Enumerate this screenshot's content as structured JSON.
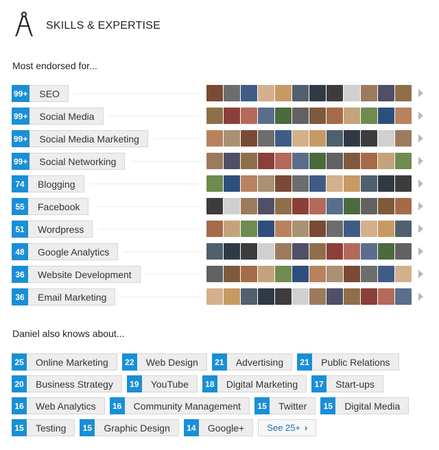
{
  "header": {
    "title": "SKILLS & EXPERTISE",
    "icon": "compass-icon"
  },
  "most_endorsed": {
    "label": "Most endorsed for...",
    "skills": [
      {
        "count": "99+",
        "name": "SEO"
      },
      {
        "count": "99+",
        "name": "Social Media"
      },
      {
        "count": "99+",
        "name": "Social Media Marketing"
      },
      {
        "count": "99+",
        "name": "Social Networking"
      },
      {
        "count": "74",
        "name": "Blogging"
      },
      {
        "count": "55",
        "name": "Facebook"
      },
      {
        "count": "51",
        "name": "Wordpress"
      },
      {
        "count": "48",
        "name": "Google Analytics"
      },
      {
        "count": "36",
        "name": "Website Development"
      },
      {
        "count": "36",
        "name": "Email Marketing"
      }
    ]
  },
  "also_knows": {
    "label": "Daniel also knows about...",
    "rows": [
      [
        {
          "count": "25",
          "name": "Online Marketing"
        },
        {
          "count": "22",
          "name": "Web Design"
        },
        {
          "count": "21",
          "name": "Advertising"
        },
        {
          "count": "21",
          "name": "Public Relations"
        }
      ],
      [
        {
          "count": "20",
          "name": "Business Strategy"
        },
        {
          "count": "19",
          "name": "YouTube"
        },
        {
          "count": "18",
          "name": "Digital Marketing"
        },
        {
          "count": "17",
          "name": "Start-ups"
        }
      ],
      [
        {
          "count": "16",
          "name": "Web Analytics"
        },
        {
          "count": "16",
          "name": "Community Management"
        },
        {
          "count": "15",
          "name": "Twitter"
        },
        {
          "count": "15",
          "name": "Digital Media"
        }
      ],
      [
        {
          "count": "15",
          "name": "Testing"
        },
        {
          "count": "15",
          "name": "Graphic Design"
        },
        {
          "count": "14",
          "name": "Google+"
        }
      ]
    ],
    "see_more": "See 25+"
  },
  "colors": {
    "accent": "#1a8fd6",
    "pill_bg": "#ededed",
    "link": "#1a6fb2"
  }
}
